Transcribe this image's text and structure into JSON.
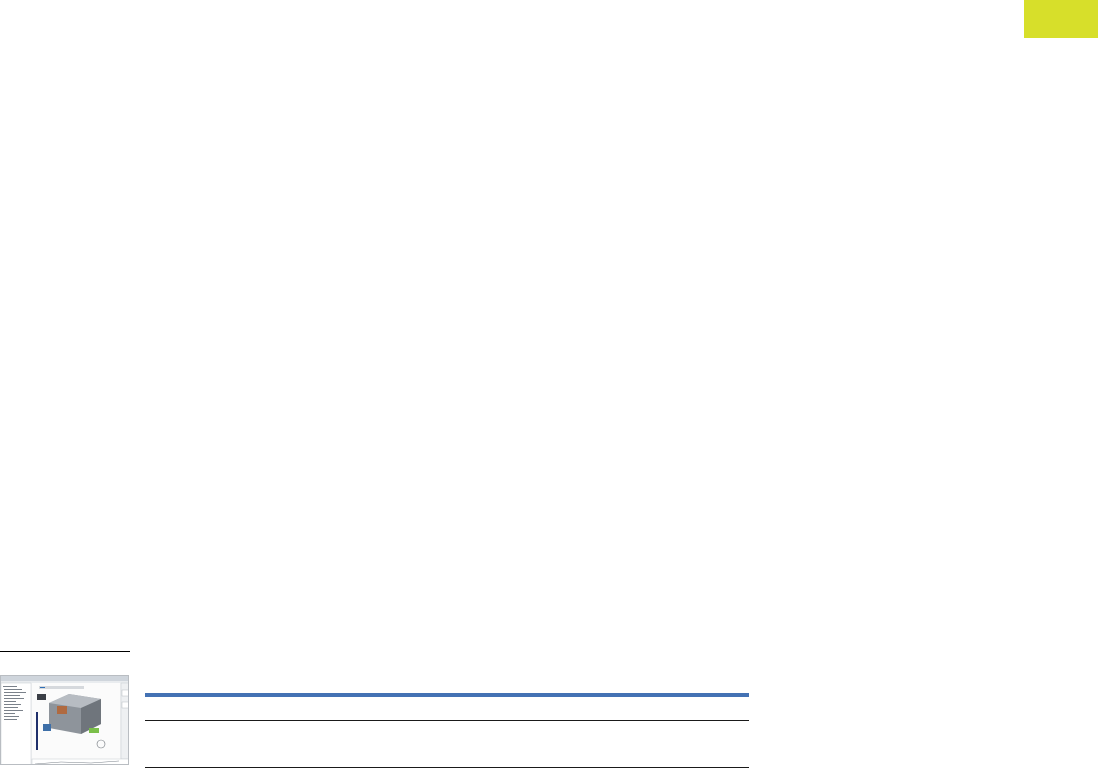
{
  "page": {
    "accent_color": "#d7df2a",
    "table_header_color": "#4472b4"
  },
  "figure": {
    "thumbnail": {
      "description_icon": "software-screenshot-thumbnail"
    }
  }
}
